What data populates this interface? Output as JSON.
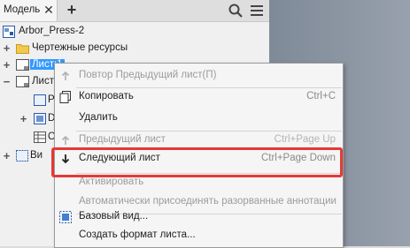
{
  "browser": {
    "tab_label": "Модель",
    "close_glyph": "✕",
    "add_glyph": "+"
  },
  "tree": {
    "root_label": "Arbor_Press-2",
    "items": [
      {
        "label": "Чертежные ресурсы"
      },
      {
        "label": "Лист:1"
      },
      {
        "label": "Лист:"
      },
      {
        "label": "Ра"
      },
      {
        "label": "Dl"
      },
      {
        "label": "СП"
      },
      {
        "label": "Ви"
      }
    ]
  },
  "context_menu": {
    "items": [
      {
        "label": "Повтор Предыдущий лист(П)",
        "shortcut": "",
        "disabled": true,
        "icon": "repeat-arrow-icon"
      },
      {
        "label": "Копировать",
        "shortcut": "Ctrl+C",
        "disabled": false,
        "icon": "copy-icon"
      },
      {
        "label": "Удалить",
        "shortcut": "",
        "disabled": false,
        "icon": ""
      },
      {
        "label": "Предыдущий лист",
        "shortcut": "Ctrl+Page Up",
        "disabled": true,
        "icon": "arrow-up-icon"
      },
      {
        "label": "Следующий лист",
        "shortcut": "Ctrl+Page Down",
        "disabled": false,
        "icon": "arrow-down-icon"
      },
      {
        "label": "Активировать",
        "shortcut": "",
        "disabled": true,
        "icon": ""
      },
      {
        "label": "Автоматически присоединять разорванные аннотации",
        "shortcut": "",
        "disabled": true,
        "icon": ""
      },
      {
        "label": "Базовый вид...",
        "shortcut": "",
        "disabled": false,
        "icon": "base-view-icon"
      },
      {
        "label": "Создать формат листа...",
        "shortcut": "",
        "disabled": false,
        "icon": ""
      }
    ]
  },
  "colors": {
    "highlight": "#e53935",
    "folder": "#f2c94c",
    "selection": "#3399ff"
  }
}
